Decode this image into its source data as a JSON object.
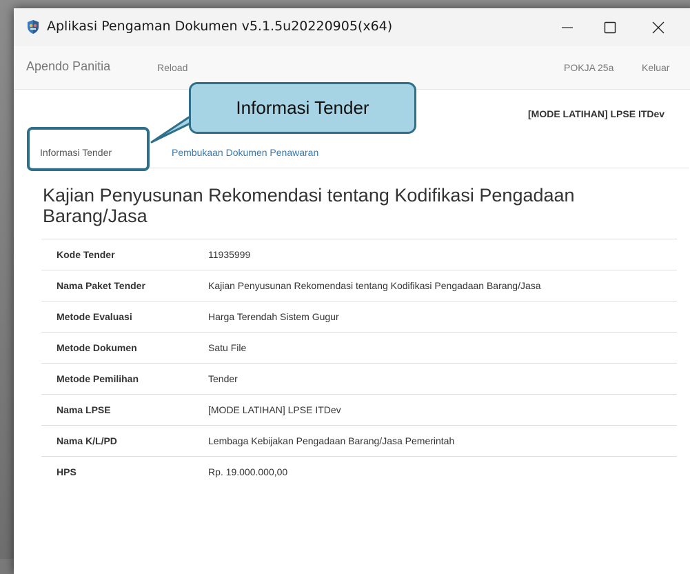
{
  "window": {
    "title": "Aplikasi Pengaman Dokumen v5.1.5u20220905(x64)",
    "icons": {
      "app": "app-shield-icon",
      "minimize": "minimize-icon",
      "maximize": "maximize-icon",
      "close": "close-icon"
    }
  },
  "navbar": {
    "brand": "Apendo Panitia",
    "reload": "Reload",
    "user": "POKJA 25a",
    "logout": "Keluar"
  },
  "header": {
    "mode": "[MODE LATIHAN] LPSE ITDev"
  },
  "tabs": [
    {
      "label": "Informasi Tender",
      "active": true
    },
    {
      "label": "Pembukaan Dokumen Penawaran",
      "active": false
    }
  ],
  "callout": {
    "text": "Informasi Tender"
  },
  "main": {
    "title": "Kajian Penyusunan Rekomendasi tentang Kodifikasi Pengadaan Barang/Jasa",
    "rows": [
      {
        "label": "Kode Tender",
        "value": "11935999"
      },
      {
        "label": "Nama Paket Tender",
        "value": "Kajian Penyusunan Rekomendasi tentang Kodifikasi Pengadaan Barang/Jasa"
      },
      {
        "label": "Metode Evaluasi",
        "value": "Harga Terendah Sistem Gugur"
      },
      {
        "label": "Metode Dokumen",
        "value": "Satu File"
      },
      {
        "label": "Metode Pemilihan",
        "value": "Tender"
      },
      {
        "label": "Nama LPSE",
        "value": "[MODE LATIHAN] LPSE ITDev"
      },
      {
        "label": "Nama K/L/PD",
        "value": "Lembaga Kebijakan Pengadaan Barang/Jasa Pemerintah"
      },
      {
        "label": "HPS",
        "value": "Rp. 19.000.000,00"
      }
    ]
  },
  "colors": {
    "link": "#337ab7",
    "callout_fill": "#a7d4e5",
    "callout_border": "#2f6f8a"
  }
}
